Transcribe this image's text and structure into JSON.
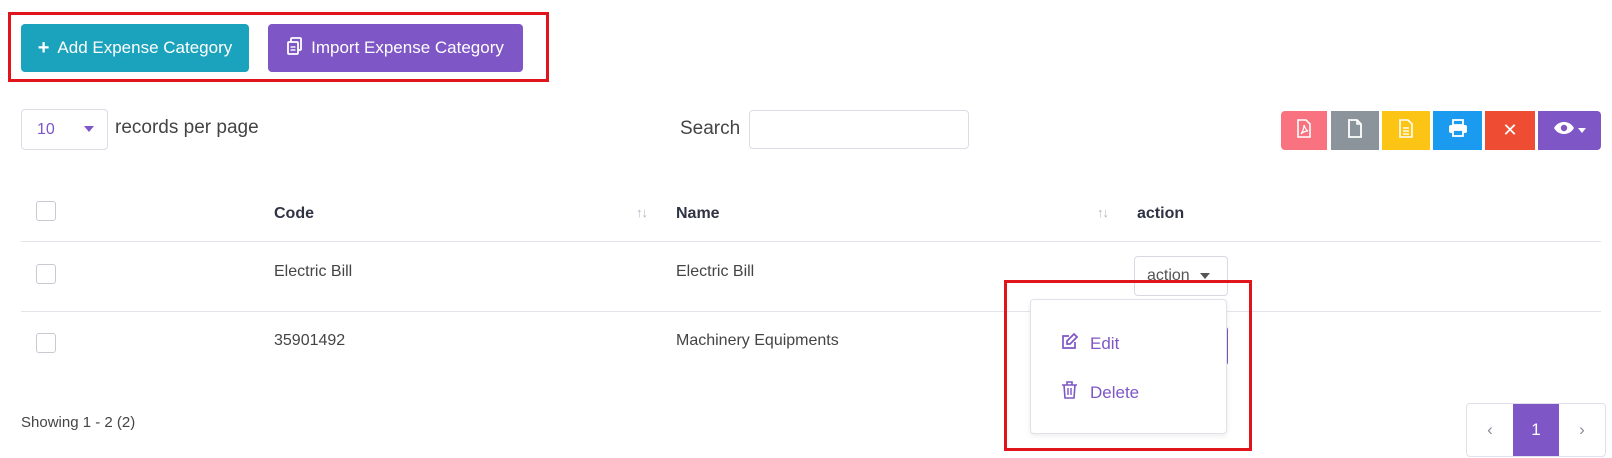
{
  "toolbar": {
    "add_label": "Add Expense Category",
    "import_label": "Import Expense Category"
  },
  "records": {
    "per_page_value": "10",
    "per_page_label": "records per page"
  },
  "search": {
    "label": "Search",
    "value": "",
    "placeholder": ""
  },
  "export_tools": [
    "pdf-icon",
    "csv-file-icon",
    "excel-file-icon",
    "print-icon",
    "close-icon",
    "eye-icon"
  ],
  "table": {
    "columns": [
      "Code",
      "Name",
      "action"
    ],
    "rows": [
      {
        "code": "Electric Bill",
        "name": "Electric Bill",
        "action": "action"
      },
      {
        "code": "35901492",
        "name": "Machinery Equipments",
        "action": ""
      }
    ]
  },
  "dropdown": {
    "edit": "Edit",
    "delete": "Delete"
  },
  "footer": {
    "showing": "Showing 1 - 2 (2)"
  },
  "pagination": {
    "prev": "‹",
    "current": "1",
    "next": "›"
  },
  "colors": {
    "primary_purple": "#7e56c6",
    "teal": "#1ba3bd",
    "highlight_red": "#e0151b"
  }
}
